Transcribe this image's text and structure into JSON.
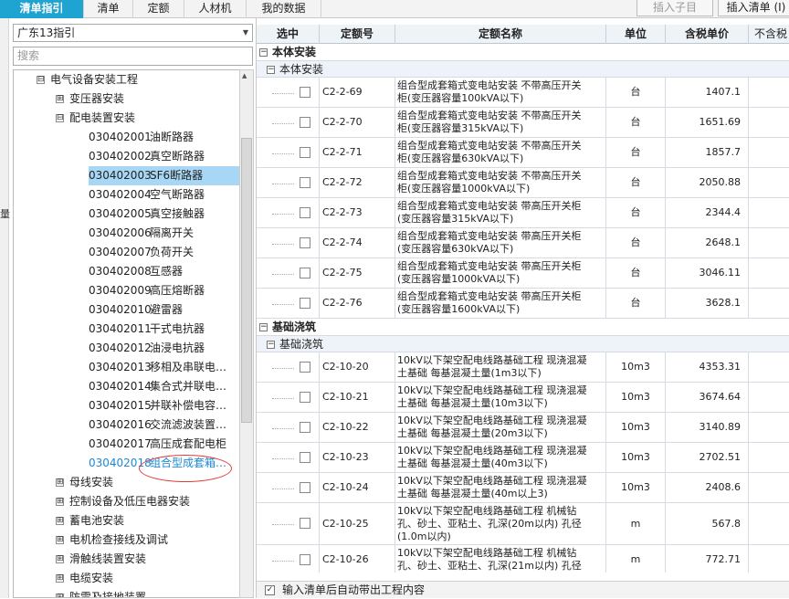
{
  "tabs": [
    "清单指引",
    "清单",
    "定额",
    "人材机",
    "我的数据"
  ],
  "toolbar": {
    "insert_child": "插入子目",
    "insert_list": "插入清单 (I)"
  },
  "left_edge_char": "量",
  "left": {
    "dropdown_value": "广东13指引",
    "search_placeholder": "搜索",
    "tree": [
      {
        "label": "电气设备安装工程",
        "toggle": "⊟"
      },
      {
        "label": "变压器安装",
        "toggle": "⊞"
      },
      {
        "label": "配电装置安装",
        "toggle": "⊟"
      },
      {
        "code": "030402001",
        "name": "油断路器"
      },
      {
        "code": "030402002",
        "name": "真空断路器"
      },
      {
        "code": "030402003",
        "name": "SF6断路器"
      },
      {
        "code": "030402004",
        "name": "空气断路器"
      },
      {
        "code": "030402005",
        "name": "真空接触器"
      },
      {
        "code": "030402006",
        "name": "隔离开关"
      },
      {
        "code": "030402007",
        "name": "负荷开关"
      },
      {
        "code": "030402008",
        "name": "互感器"
      },
      {
        "code": "030402009",
        "name": "高压熔断器"
      },
      {
        "code": "030402010",
        "name": "避雷器"
      },
      {
        "code": "030402011",
        "name": "干式电抗器"
      },
      {
        "code": "030402012",
        "name": "油浸电抗器"
      },
      {
        "code": "030402013",
        "name": "移相及串联电…"
      },
      {
        "code": "030402014",
        "name": "集合式并联电…"
      },
      {
        "code": "030402015",
        "name": "并联补偿电容…"
      },
      {
        "code": "030402016",
        "name": "交流滤波装置…"
      },
      {
        "code": "030402017",
        "name": "高压成套配电柜"
      },
      {
        "code": "030402018",
        "name": "组合型成套箱…"
      },
      {
        "label": "母线安装",
        "toggle": "⊞"
      },
      {
        "label": "控制设备及低压电器安装",
        "toggle": "⊞"
      },
      {
        "label": "蓄电池安装",
        "toggle": "⊞"
      },
      {
        "label": "电机检查接线及调试",
        "toggle": "⊞"
      },
      {
        "label": "滑触线装置安装",
        "toggle": "⊞"
      },
      {
        "label": "电缆安装",
        "toggle": "⊞"
      },
      {
        "label": "防雷及接地装置",
        "toggle": "⊞"
      }
    ]
  },
  "grid": {
    "headers": [
      "选中",
      "定额号",
      "定额名称",
      "单位",
      "含税单价",
      "不含税"
    ],
    "groups": [
      {
        "title": "本体安装",
        "sub": "本体安装",
        "rows": [
          {
            "code": "C2-2-69",
            "name1": "组合型成套箱式变电站安装 不带高压开关",
            "name2": "柜(变压器容量100kVA以下)",
            "unit": "台",
            "price": "1407.1"
          },
          {
            "code": "C2-2-70",
            "name1": "组合型成套箱式变电站安装 不带高压开关",
            "name2": "柜(变压器容量315kVA以下)",
            "unit": "台",
            "price": "1651.69"
          },
          {
            "code": "C2-2-71",
            "name1": "组合型成套箱式变电站安装 不带高压开关",
            "name2": "柜(变压器容量630kVA以下)",
            "unit": "台",
            "price": "1857.7"
          },
          {
            "code": "C2-2-72",
            "name1": "组合型成套箱式变电站安装 不带高压开关",
            "name2": "柜(变压器容量1000kVA以下)",
            "unit": "台",
            "price": "2050.88"
          },
          {
            "code": "C2-2-73",
            "name1": "组合型成套箱式变电站安装 带高压开关柜",
            "name2": "(变压器容量315kVA以下)",
            "unit": "台",
            "price": "2344.4"
          },
          {
            "code": "C2-2-74",
            "name1": "组合型成套箱式变电站安装 带高压开关柜",
            "name2": "(变压器容量630kVA以下)",
            "unit": "台",
            "price": "2648.1"
          },
          {
            "code": "C2-2-75",
            "name1": "组合型成套箱式变电站安装 带高压开关柜",
            "name2": "(变压器容量1000kVA以下)",
            "unit": "台",
            "price": "3046.11"
          },
          {
            "code": "C2-2-76",
            "name1": "组合型成套箱式变电站安装 带高压开关柜",
            "name2": "(变压器容量1600kVA以下)",
            "unit": "台",
            "price": "3628.1"
          }
        ]
      },
      {
        "title": "基础浇筑",
        "sub": "基础浇筑",
        "rows": [
          {
            "code": "C2-10-20",
            "name1": "10kV以下架空配电线路基础工程 现浇混凝",
            "name2": "土基础 每基混凝土量(1m3以下)",
            "unit": "10m3",
            "price": "4353.31"
          },
          {
            "code": "C2-10-21",
            "name1": "10kV以下架空配电线路基础工程 现浇混凝",
            "name2": "土基础 每基混凝土量(10m3以下)",
            "unit": "10m3",
            "price": "3674.64"
          },
          {
            "code": "C2-10-22",
            "name1": "10kV以下架空配电线路基础工程 现浇混凝",
            "name2": "土基础 每基混凝土量(20m3以下)",
            "unit": "10m3",
            "price": "3140.89"
          },
          {
            "code": "C2-10-23",
            "name1": "10kV以下架空配电线路基础工程 现浇混凝",
            "name2": "土基础 每基混凝土量(40m3以下)",
            "unit": "10m3",
            "price": "2702.51"
          },
          {
            "code": "C2-10-24",
            "name1": "10kV以下架空配电线路基础工程 现浇混凝",
            "name2": "土基础 每基混凝土量(40m以上3)",
            "unit": "10m3",
            "price": "2408.6"
          },
          {
            "code": "C2-10-25",
            "name1": "10kV以下架空配电线路基础工程 机械钻",
            "name2": "孔、砂土、亚粘土、孔深(20m以内) 孔径",
            "name3": "(1.0m以内)",
            "unit": "m",
            "price": "567.8"
          },
          {
            "code": "C2-10-26",
            "name1": "10kV以下架空配电线路基础工程 机械钻",
            "name2": "孔、砂土、亚粘土、孔深(21m以内) 孔径",
            "unit": "m",
            "price": "772.71"
          }
        ]
      }
    ]
  },
  "bottom": {
    "checkbox_label": "输入清单后自动带出工程内容"
  }
}
